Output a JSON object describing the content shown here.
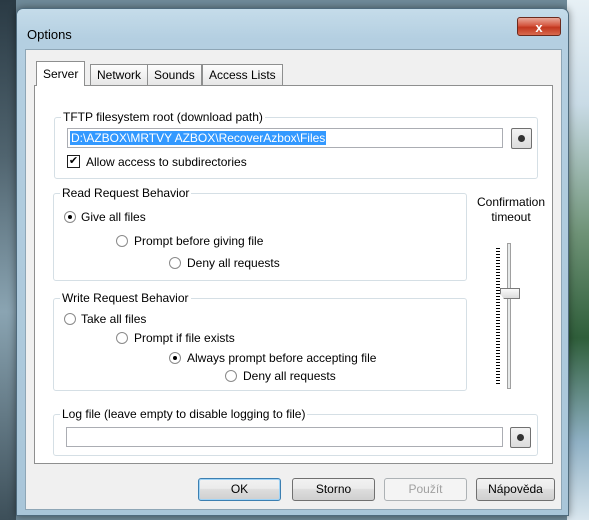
{
  "window": {
    "title": "Options",
    "close_glyph": "x"
  },
  "tabs": [
    {
      "label": "Server",
      "active": true
    },
    {
      "label": "Network",
      "active": false
    },
    {
      "label": "Sounds",
      "active": false
    },
    {
      "label": "Access Lists",
      "active": false
    }
  ],
  "tftp_root": {
    "legend": "TFTP filesystem root (download path)",
    "path": "D:\\AZBOX\\MRTVY AZBOX\\RecoverAzbox\\Files",
    "allow_subdirs_label": "Allow access to subdirectories",
    "allow_subdirs_checked": true,
    "check_glyph": "✔"
  },
  "read_behavior": {
    "legend": "Read Request Behavior",
    "options": [
      {
        "label": "Give all files",
        "selected": true
      },
      {
        "label": "Prompt before giving file",
        "selected": false
      },
      {
        "label": "Deny all requests",
        "selected": false
      }
    ]
  },
  "write_behavior": {
    "legend": "Write Request Behavior",
    "options": [
      {
        "label": "Take all files",
        "selected": false
      },
      {
        "label": "Prompt if file exists",
        "selected": false
      },
      {
        "label": "Always prompt before accepting file",
        "selected": true
      },
      {
        "label": "Deny all requests",
        "selected": false
      }
    ]
  },
  "confirmation": {
    "label_line1": "Confirmation",
    "label_line2": "timeout"
  },
  "log_file": {
    "legend": "Log file (leave empty to disable logging to file)",
    "value": ""
  },
  "buttons": {
    "ok": "OK",
    "cancel": "Storno",
    "apply": "Použít",
    "help": "Nápověda"
  }
}
